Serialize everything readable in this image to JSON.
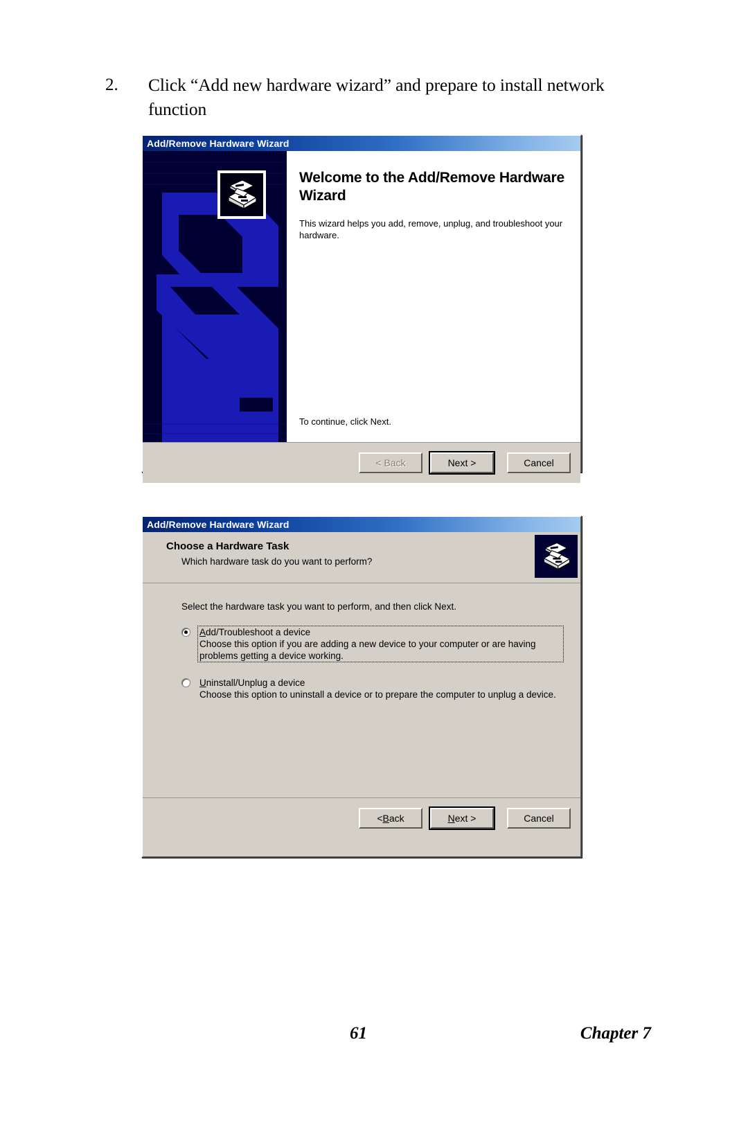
{
  "document": {
    "step_number": "2.",
    "step_text": "Click “Add new hardware wizard” and prepare to install network function",
    "page_number": "61",
    "chapter_label": "Chapter 7"
  },
  "dialog_welcome": {
    "titlebar": "Add/Remove Hardware Wizard",
    "heading": "Welcome to the Add/Remove Hardware Wizard",
    "paragraph": "This wizard helps you add, remove, unplug, and troubleshoot your hardware.",
    "continue_text": "To continue, click Next.",
    "banner_icon_name": "hardware-device-icon",
    "buttons": {
      "back": "< Back",
      "next": "Next >",
      "cancel": "Cancel"
    }
  },
  "dialog_task": {
    "titlebar": "Add/Remove Hardware Wizard",
    "title": "Choose a Hardware Task",
    "subtitle": "Which hardware task do you want to perform?",
    "header_icon_name": "hardware-device-icon",
    "intro": "Select the hardware task you want to perform, and then click Next.",
    "options": [
      {
        "label": "Add/Troubleshoot a device",
        "accesskey": "A",
        "description": "Choose this option if you are adding a new device to your computer or are having problems getting a device working.",
        "selected": true,
        "focused": true
      },
      {
        "label": "Uninstall/Unplug a device",
        "accesskey": "U",
        "description": "Choose this option to uninstall a device or to prepare the computer to unplug a device.",
        "selected": false,
        "focused": false
      }
    ],
    "buttons": {
      "back": "< Back",
      "back_accesskey": "B",
      "next": "Next >",
      "next_accesskey": "N",
      "cancel": "Cancel"
    }
  },
  "colors": {
    "dialog_face": "#d4d0c8",
    "titlebar_dark": "#06246f",
    "titlebar_light": "#a6cbee",
    "banner_bg": "#000033",
    "banner_graphic": "#1a1ab4"
  }
}
